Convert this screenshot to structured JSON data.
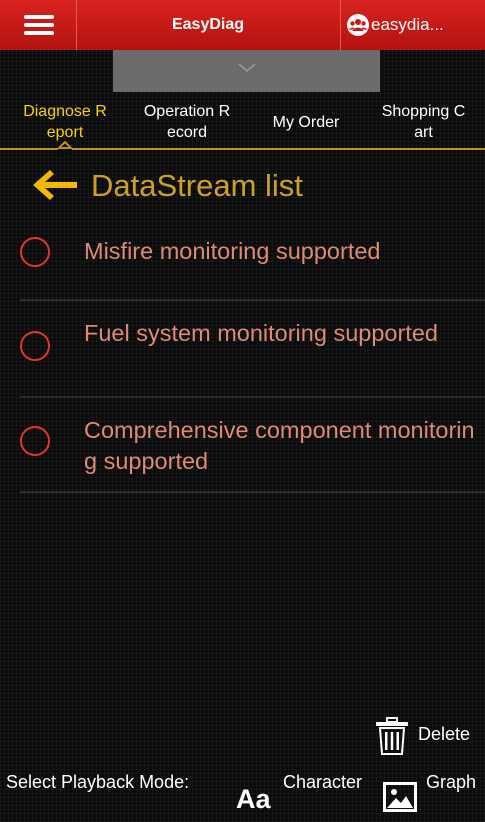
{
  "header": {
    "menu_icon": "hamburger-menu-icon",
    "app_title": "EasyDiag",
    "account_icon": "user-group-icon",
    "account_label": "easydia..."
  },
  "collapse_handle": {
    "icon": "chevron-down-icon"
  },
  "tabs": [
    {
      "label": "Diagnose Report",
      "line1": "Diagnose R",
      "line2": "eport",
      "active": true
    },
    {
      "label": "Operation Record",
      "line1": "Operation R",
      "line2": "ecord",
      "active": false
    },
    {
      "label": "My Order",
      "line1": "My Order",
      "line2": "",
      "active": false
    },
    {
      "label": "Shopping Cart",
      "line1": "Shopping C",
      "line2": "art",
      "active": false
    }
  ],
  "list": {
    "back_icon": "back-arrow-icon",
    "title": "DataStream list",
    "items": [
      {
        "text": "Misfire monitoring supported",
        "selected": false
      },
      {
        "text": "Fuel system monitoring supported",
        "selected": false
      },
      {
        "text": "Comprehensive component monitoring supported",
        "selected": false
      }
    ]
  },
  "actions": {
    "delete_icon": "trash-icon",
    "delete_label": "Delete"
  },
  "bottom_bar": {
    "playback_label": "Select Playback Mode:",
    "character_icon": "text-mode-icon",
    "character_icon_glyph": "Aa",
    "character_label": "Character",
    "graph_icon": "image-graph-icon",
    "graph_label": "Graph"
  },
  "colors": {
    "header_red": "#c81b17",
    "active_tab": "#f5d400",
    "title_gold": "#c9a225",
    "item_text": "#dd8b72",
    "radio_red": "#e3342c"
  }
}
